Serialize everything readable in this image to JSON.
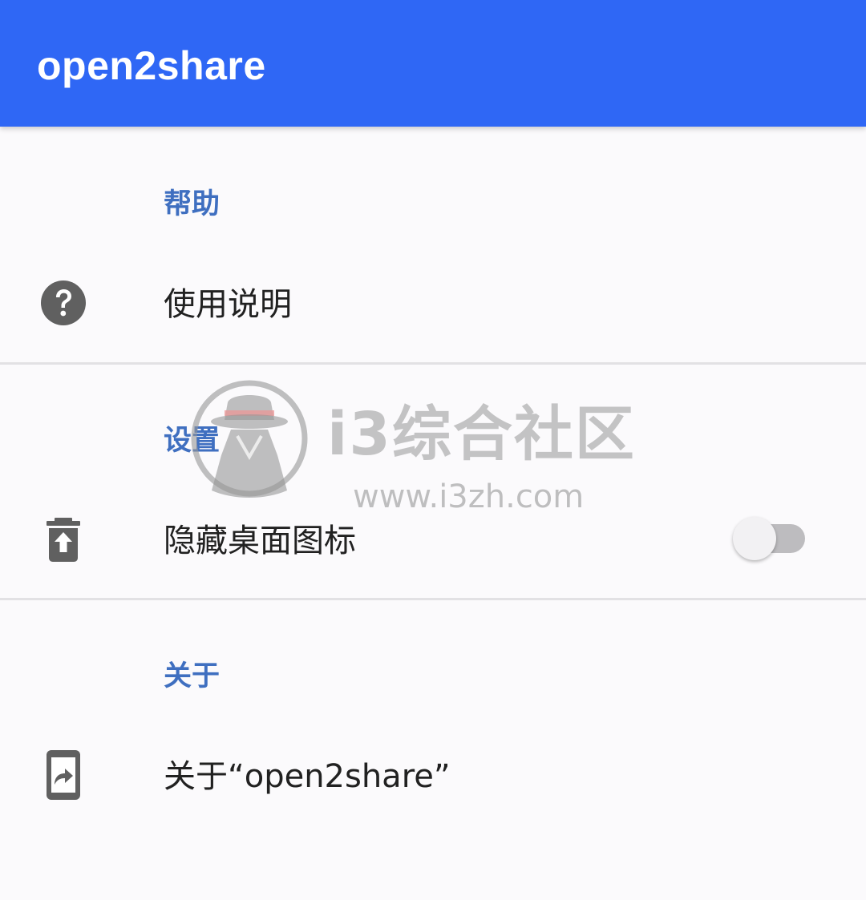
{
  "app_bar": {
    "title": "open2share",
    "color": "#2f67f5"
  },
  "sections": [
    {
      "header": "帮助",
      "items": [
        {
          "label": "使用说明",
          "icon": "help-circle-icon"
        }
      ]
    },
    {
      "header": "设置",
      "items": [
        {
          "label": "隐藏桌面图标",
          "icon": "delete-restore-icon",
          "toggle_on": false
        }
      ]
    },
    {
      "header": "关于",
      "items": [
        {
          "label": "关于“open2share”",
          "icon": "phone-share-icon"
        }
      ]
    }
  ],
  "colors": {
    "section_header": "#3f6fc0",
    "label": "#212121",
    "icon": "#606060",
    "background": "#fbfafc"
  },
  "watermark": {
    "name": "i3综合社区",
    "url": "www.i3zh.com",
    "logo": "spy-hat-logo"
  }
}
